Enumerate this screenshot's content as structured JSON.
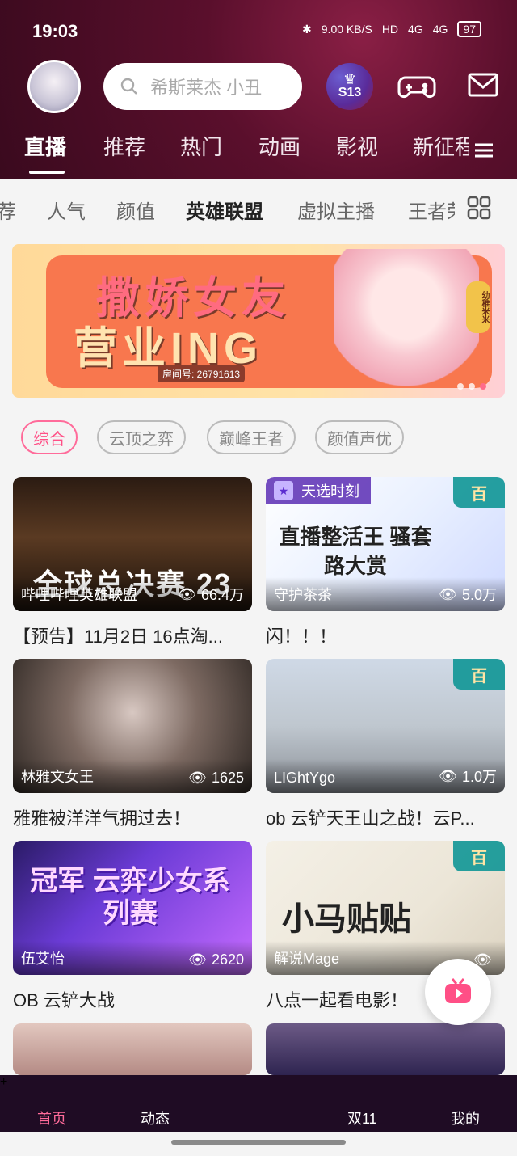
{
  "status_bar": {
    "time": "19:03",
    "network_speed": "9.00 KB/S",
    "hd": "HD",
    "signal1": "4G",
    "signal2": "4G",
    "battery": "97"
  },
  "header": {
    "search_placeholder": "希斯莱杰 小丑",
    "badge": "S13",
    "tabs": [
      "直播",
      "推荐",
      "热门",
      "动画",
      "影视",
      "新征程"
    ],
    "active_tab": "直播"
  },
  "subcategories": [
    "荐",
    "人气",
    "颜值",
    "英雄联盟",
    "虚拟主播",
    "王者荣耀"
  ],
  "active_subcategory": "英雄联盟",
  "banner": {
    "line1": "撒娇女友",
    "line2": "营业ING",
    "room_label": "房间号: 26791613",
    "side_label": "幼稚米米",
    "dots": 3,
    "active_dot": 2
  },
  "filters": [
    "综合",
    "云顶之弈",
    "巅峰王者",
    "颜值声优"
  ],
  "active_filter": "综合",
  "cards": [
    {
      "streamer": "哔哩哔哩英雄联盟",
      "views": "66.4万",
      "title": "【预告】11月2日 16点淘...",
      "overlay": "全球总决赛 23",
      "badge": "",
      "bai": ""
    },
    {
      "streamer": "守护茶茶",
      "views": "5.0万",
      "title": "闪！！！",
      "overlay": "直播整活王 骚套路大赏",
      "badge": "天选时刻",
      "bai": "百"
    },
    {
      "streamer": "林雅文女王",
      "views": "1625",
      "title": "雅雅被洋洋气拥过去！",
      "overlay": "",
      "badge": "",
      "bai": ""
    },
    {
      "streamer": "LIGhtYgo",
      "views": "1.0万",
      "title": "ob 云铲天王山之战！云P...",
      "overlay": "",
      "badge": "",
      "bai": "百"
    },
    {
      "streamer": "伍艾怡",
      "views": "2620",
      "title": "OB 云铲大战",
      "overlay": "冠军 云弈少女系列赛",
      "badge": "",
      "bai": ""
    },
    {
      "streamer": "解说Mage",
      "views": "",
      "title": "八点一起看电影！",
      "overlay": "小马贴贴",
      "badge": "",
      "bai": "百"
    }
  ],
  "bottom_nav": {
    "items": [
      "首页",
      "动态",
      "双11",
      "我的"
    ],
    "active": "首页",
    "plus": "+"
  },
  "colors": {
    "header_bg": "#5a0f2c",
    "accent": "#ff6b9a",
    "tab_text": "#ffffff"
  }
}
